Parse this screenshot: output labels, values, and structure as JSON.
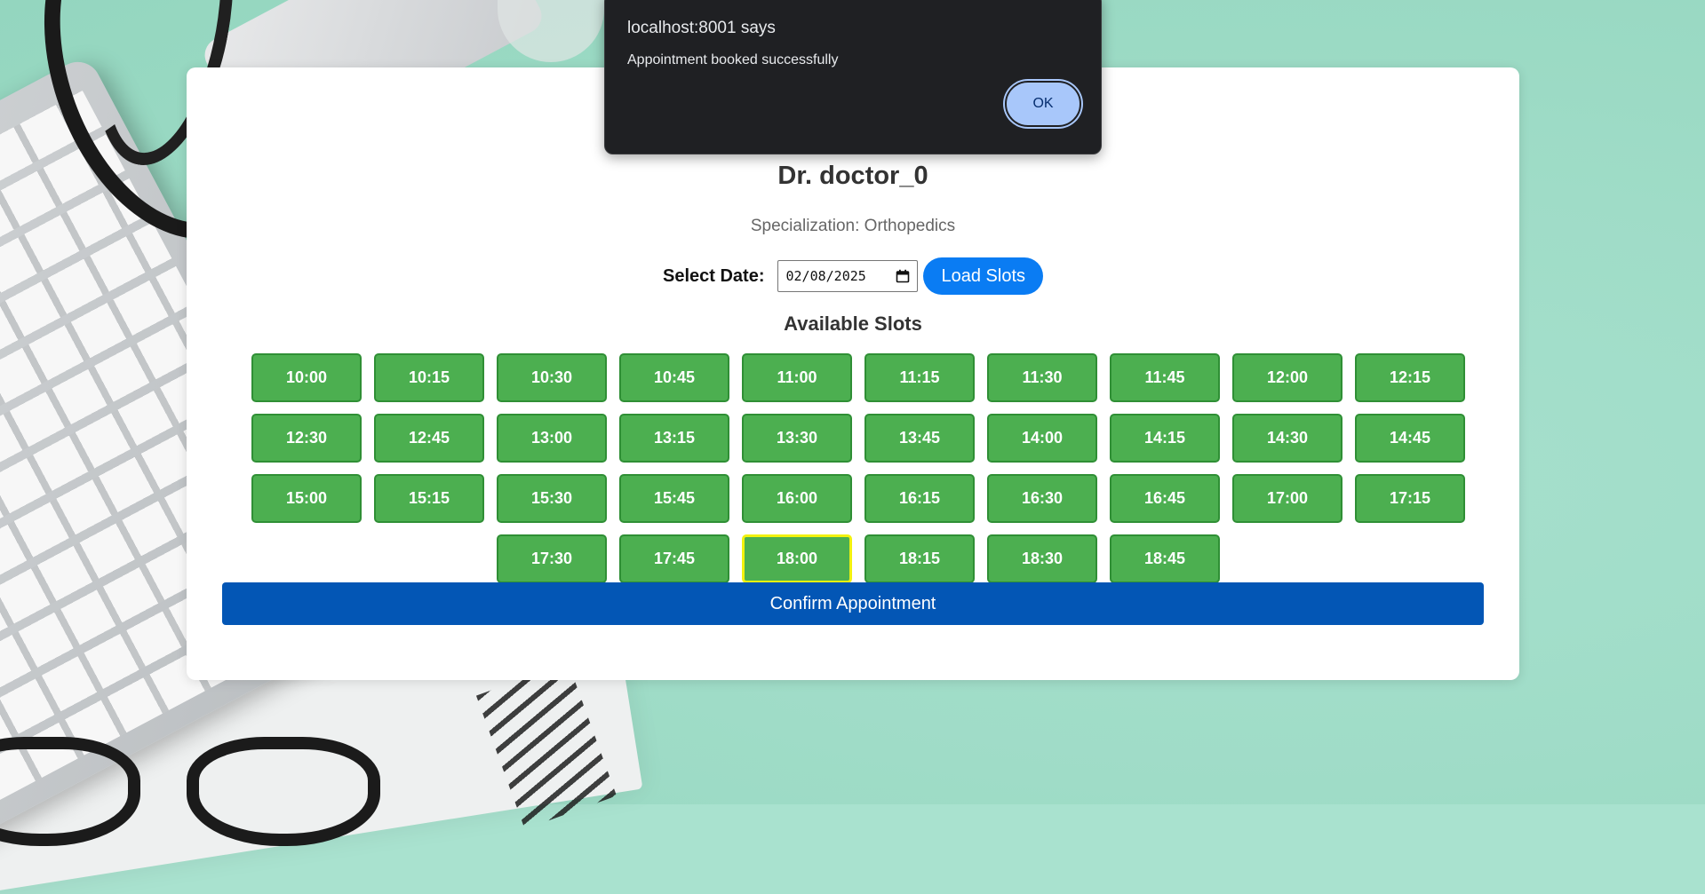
{
  "background": {
    "page_color": "#a9e2cf"
  },
  "doctor": {
    "name": "Dr. doctor_0",
    "specialization_label": "Specialization: ",
    "specialization_value": "Orthopedics"
  },
  "date_picker": {
    "label": "Select Date:",
    "value": "02/08/2025",
    "load_button": "Load Slots"
  },
  "slots": {
    "title": "Available Slots",
    "times": [
      "10:00",
      "10:15",
      "10:30",
      "10:45",
      "11:00",
      "11:15",
      "11:30",
      "11:45",
      "12:00",
      "12:15",
      "12:30",
      "12:45",
      "13:00",
      "13:15",
      "13:30",
      "13:45",
      "14:00",
      "14:15",
      "14:30",
      "14:45",
      "15:00",
      "15:15",
      "15:30",
      "15:45",
      "16:00",
      "16:15",
      "16:30",
      "16:45",
      "17:00",
      "17:15",
      "17:30",
      "17:45",
      "18:00",
      "18:15",
      "18:30",
      "18:45"
    ],
    "selected": "18:00",
    "colors": {
      "slot": "#4caf50",
      "selected_outline": "#f2f20e"
    }
  },
  "confirm_button": "Confirm Appointment",
  "alert": {
    "title": "localhost:8001 says",
    "message": "Appointment booked successfully",
    "ok_label": "OK"
  },
  "colors": {
    "primary_button": "#0a7cf3",
    "confirm_button": "#0356b5",
    "alert_background": "#1f2023",
    "alert_ok": "#a8c7fa"
  }
}
